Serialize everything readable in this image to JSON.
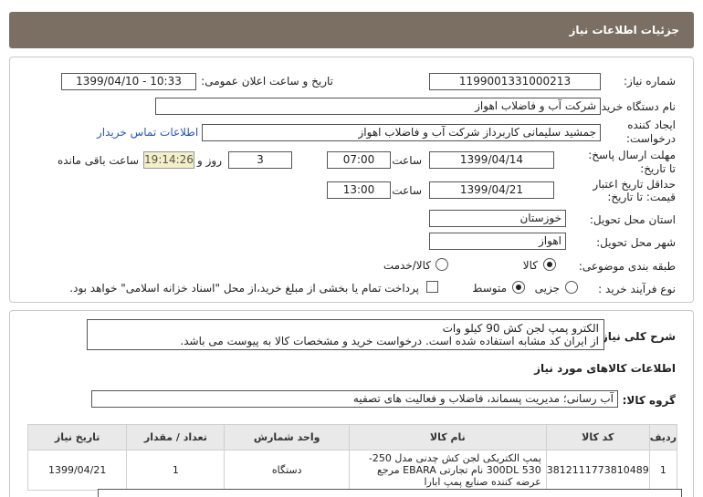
{
  "header": {
    "title": "جزئیات اطلاعات نیاز"
  },
  "form": {
    "need_number_label": "شماره نیاز:",
    "need_number": "1199001331000213",
    "announce_label": "تاریخ و ساعت اعلان عمومی:",
    "announce_value": "1399/04/10 - 10:33",
    "buyer_label": "نام دستگاه خریدار:",
    "buyer_value": "شرکت آب و فاضلاب اهواز",
    "creator_label_1": "ایجاد کننده",
    "creator_label_2": "درخواست:",
    "creator_value": "جمشید سلیمانی کاربرداز شرکت آب و فاضلاب اهواز",
    "contact_link": "اطلاعات تماس خریدار",
    "send_deadline_label_1": "مهلت ارسال پاسخ:",
    "send_deadline_label_2": "تا تاریخ:",
    "send_date": "1399/04/14",
    "time_label": "ساعت",
    "send_time": "07:00",
    "days_value": "3",
    "days_label": "روز و",
    "remaining_time": "19:14:26",
    "remaining_label": "ساعت باقی مانده",
    "validity_label_1": "حداقل تاریخ اعتبار",
    "validity_label_2": "قیمت: تا تاریخ:",
    "validity_date": "1399/04/21",
    "validity_time": "13:00",
    "province_label": "استان محل تحویل:",
    "province_value": "خوزستان",
    "city_label": "شهر محل تحویل:",
    "city_value": "اهواز",
    "category_label": "طبقه بندی موضوعی:",
    "category_options": [
      "کالا",
      "کالا/خدمت"
    ],
    "process_label": "نوع فرآیند خرید :",
    "process_options": [
      "جزیی",
      "متوسط"
    ],
    "payment_note": "پرداخت تمام یا بخشی از مبلغ خرید،از محل \"اسناد خزانه اسلامی\" خواهد بود."
  },
  "summary": {
    "label": "شرح کلی نیاز:",
    "line1": "الکترو پمپ لجن کش 90 کیلو وات",
    "line2": "از ایران کد مشابه استفاده شده است. درخواست خرید و مشخصات کالا به پیوست می باشد."
  },
  "goods": {
    "section_title": "اطلاعات کالاهای مورد نیاز",
    "group_label": "گروه کالا:",
    "group_value": "آب رسانی؛ مدیریت پسماند، فاضلاب و فعالیت های تصفیه",
    "columns": [
      "ردیف",
      "کد کالا",
      "نام کالا",
      "واحد شمارش",
      "تعداد / مقدار",
      "تاریخ نیاز"
    ],
    "rows": [
      {
        "row": "1",
        "code": "3812111773810489",
        "name": "پمپ الکتریکی لجن کش چدنی مدل 250-530 300DL نام تجارتی EBARA مرجع عرضه کننده صنایع پمپ ابارا",
        "unit": "دستگاه",
        "qty": "1",
        "date": "1399/04/21"
      }
    ]
  }
}
